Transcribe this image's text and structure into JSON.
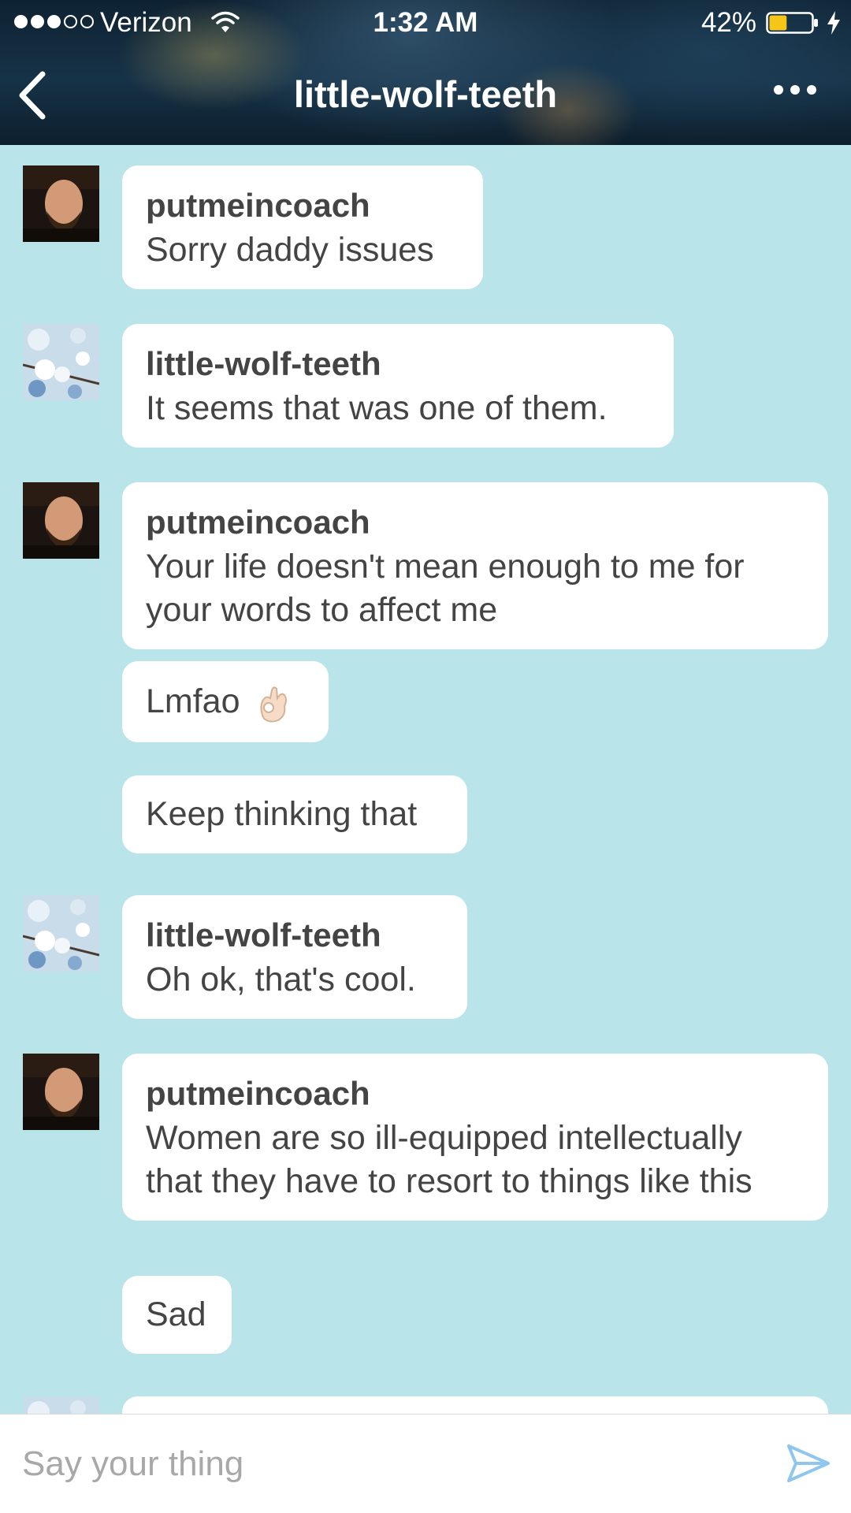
{
  "status_bar": {
    "carrier": "Verizon",
    "time": "1:32 AM",
    "battery": "42%",
    "battery_level": 0.42,
    "signal_bars": 3,
    "signal_total": 5
  },
  "nav": {
    "title": "little-wolf-teeth",
    "back_icon": "chevron-left-icon",
    "more_icon": "ellipsis-icon"
  },
  "messages": [
    {
      "sender": "putmeincoach",
      "text": "Sorry daddy issues"
    },
    {
      "sender": "little-wolf-teeth",
      "text": "It seems that was one of them."
    },
    {
      "sender": "putmeincoach",
      "text": "Your life doesn't mean enough to me for your words to affect me"
    },
    {
      "text": "Lmfao",
      "emoji": "ok-hand-emoji"
    },
    {
      "text": "Keep thinking that"
    },
    {
      "sender": "little-wolf-teeth",
      "text": "Oh ok, that's cool."
    },
    {
      "sender": "putmeincoach",
      "text": "Women are so ill-equipped intellectually that they have to resort to things like this"
    },
    {
      "text": "Sad"
    }
  ],
  "composer": {
    "placeholder": "Say your thing",
    "send_icon": "send-icon"
  },
  "colors": {
    "background": "#b8e4ea",
    "bubble": "#ffffff",
    "text": "#444444",
    "send_accent": "#8fc6ee"
  }
}
